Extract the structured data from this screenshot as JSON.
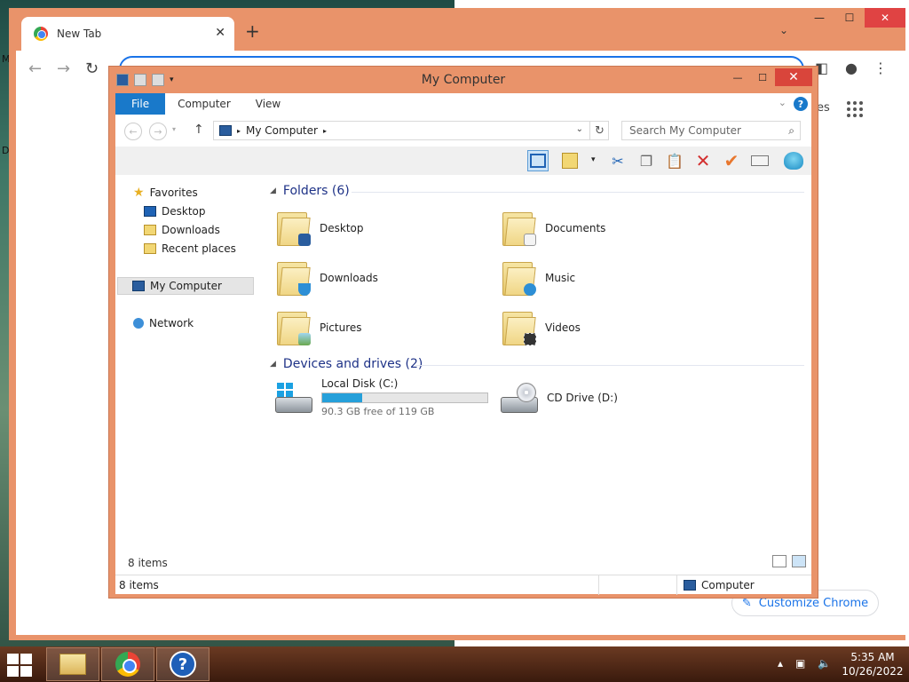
{
  "chrome": {
    "tab_title": "New Tab",
    "customize_label": "Customize Chrome",
    "partial_text": "es"
  },
  "explorer": {
    "window_title": "My Computer",
    "ribbon_tabs": [
      {
        "label": "File"
      },
      {
        "label": "Computer"
      },
      {
        "label": "View"
      }
    ],
    "address_path": "My Computer",
    "search_placeholder": "Search My Computer",
    "nav": {
      "favorites": "Favorites",
      "desktop": "Desktop",
      "downloads": "Downloads",
      "recent": "Recent places",
      "my_computer": "My Computer",
      "network": "Network"
    },
    "folders_header": "Folders (6)",
    "folders": [
      {
        "name": "Desktop",
        "badge": "desktop"
      },
      {
        "name": "Documents",
        "badge": "document"
      },
      {
        "name": "Downloads",
        "badge": "download-arrow"
      },
      {
        "name": "Music",
        "badge": "music-note"
      },
      {
        "name": "Pictures",
        "badge": "picture"
      },
      {
        "name": "Videos",
        "badge": "film"
      }
    ],
    "drives_header": "Devices and drives (2)",
    "drives": [
      {
        "name": "Local Disk (C:)",
        "free_text": "90.3 GB free of 119 GB",
        "used_fraction": 0.24,
        "type": "hdd"
      },
      {
        "name": "CD Drive (D:)",
        "type": "cd"
      }
    ],
    "content_status": "8 items",
    "status_left": "8 items",
    "status_right": "Computer"
  },
  "taskbar": {
    "time": "5:35 AM",
    "date": "10/26/2022"
  },
  "edge_letters": {
    "m": "M",
    "d": "D"
  },
  "colors": {
    "window_frame": "#e9936a",
    "accent_blue": "#1979ca",
    "drive_fill": "#26a0da",
    "close_red": "#d9453b"
  }
}
